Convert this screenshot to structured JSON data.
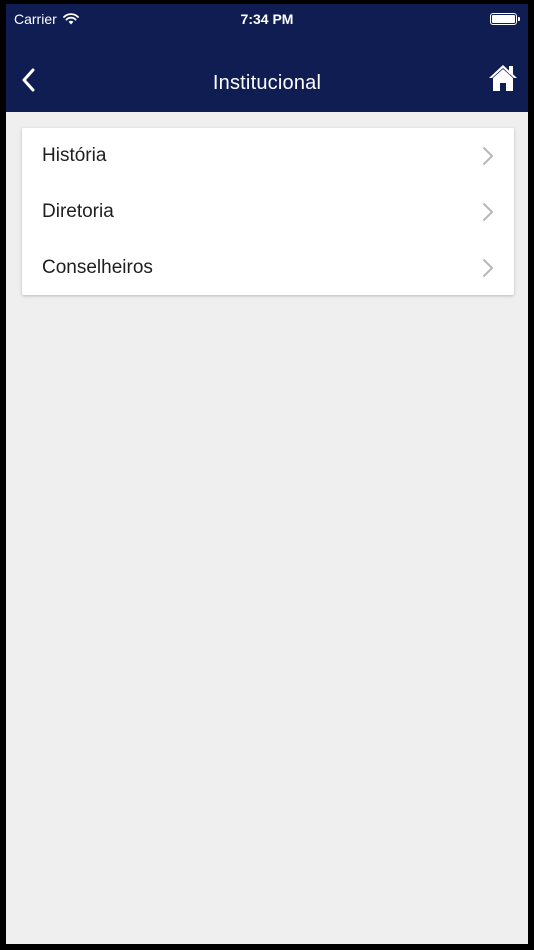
{
  "status_bar": {
    "carrier": "Carrier",
    "time": "7:34 PM",
    "wifi_icon": "wifi-icon",
    "battery_icon": "battery-icon"
  },
  "nav": {
    "title": "Institucional",
    "back_icon": "chevron-left-icon",
    "home_icon": "home-icon"
  },
  "menu": {
    "items": [
      {
        "label": "História"
      },
      {
        "label": "Diretoria"
      },
      {
        "label": "Conselheiros"
      }
    ],
    "chevron_icon": "chevron-right-icon"
  },
  "colors": {
    "header_bg": "#0f1d52",
    "page_bg": "#efefef",
    "card_bg": "#ffffff",
    "chevron": "#b8b8b8"
  }
}
